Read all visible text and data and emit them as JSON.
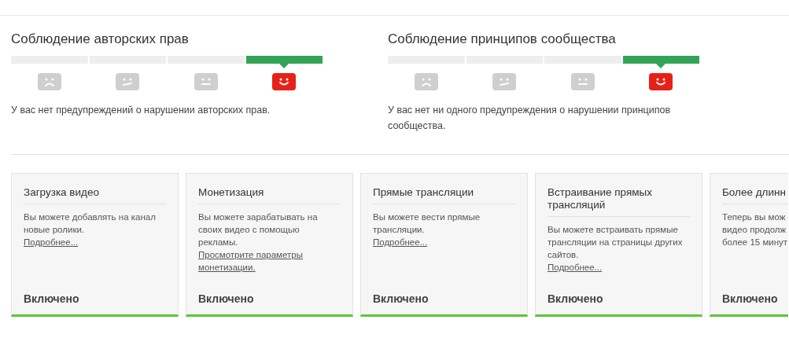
{
  "standings": [
    {
      "title": "Соблюдение авторских прав",
      "message": "У вас нет предупреждений о нарушении авторских прав.",
      "levels": [
        {
          "kind": "sad",
          "selected": false
        },
        {
          "kind": "uneasy",
          "selected": false
        },
        {
          "kind": "neutral",
          "selected": false
        },
        {
          "kind": "happy",
          "selected": true
        }
      ]
    },
    {
      "title": "Соблюдение принципов сообщества",
      "message": "У вас нет ни одного предупреждения о нарушении принципов сообщества.",
      "levels": [
        {
          "kind": "sad",
          "selected": false
        },
        {
          "kind": "uneasy",
          "selected": false
        },
        {
          "kind": "neutral",
          "selected": false
        },
        {
          "kind": "happy",
          "selected": true
        }
      ]
    }
  ],
  "features": [
    {
      "kind": "full",
      "title": "Загрузка видео",
      "description": "Вы можете добавлять на канал новые ролики.",
      "link": "Подробнее...",
      "status": "Включено",
      "enabled": true
    },
    {
      "kind": "full",
      "title": "Монетизация",
      "description": "Вы можете зарабатывать на своих видео с помощью рекламы.",
      "link": "Просмотрите параметры монетизации.",
      "status": "Включено",
      "enabled": true
    },
    {
      "kind": "full",
      "title": "Прямые трансляции",
      "description": "Вы можете вести прямые трансляции.",
      "link": "Подробнее...",
      "status": "Включено",
      "enabled": true
    },
    {
      "kind": "full",
      "title": "Встраивание прямых трансляций",
      "description": "Вы можете встраивать прямые трансляции на страницы других сайтов.",
      "link": "Подробнее...",
      "status": "Включено",
      "enabled": true
    },
    {
      "kind": "clipped",
      "title": "Более длинн",
      "description_lines": [
        "Теперь вы мож",
        "видео продолж",
        "более 15 минут"
      ],
      "status": "Включено",
      "enabled": true
    }
  ]
}
